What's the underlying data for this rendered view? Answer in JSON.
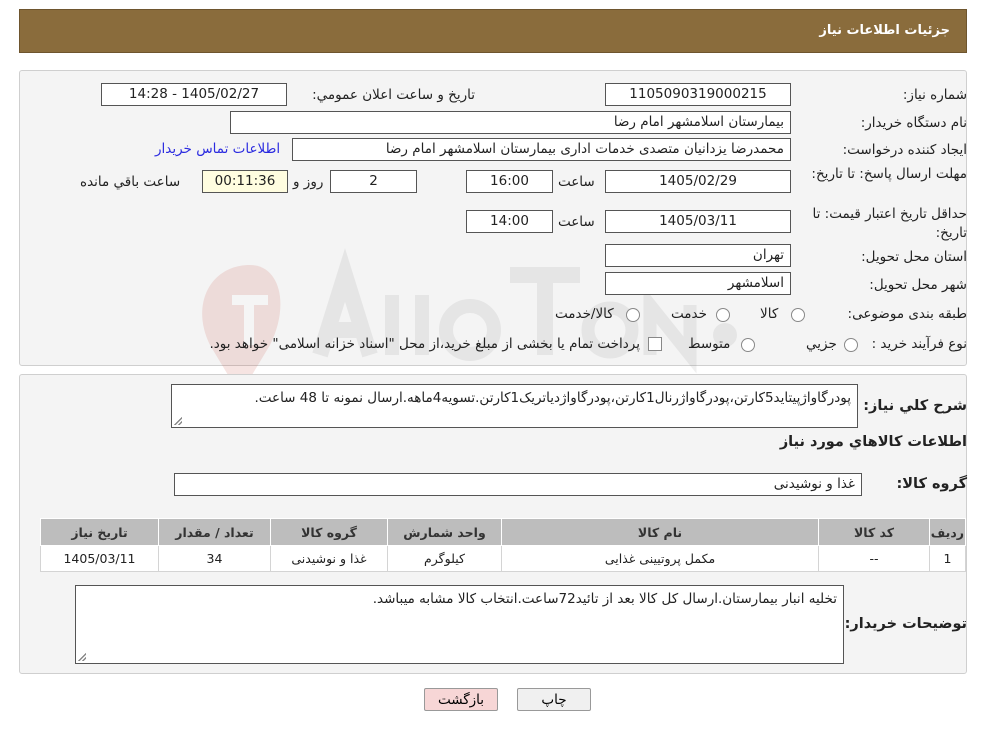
{
  "header": {
    "title": "جزئیات اطلاعات نیاز"
  },
  "labels": {
    "need_number": "شماره نیاز:",
    "announce_datetime": "تاريخ و ساعت اعلان عمومي:",
    "buyer_org": "نام دستگاه خريدار:",
    "requester": "ایجاد کننده درخواست:",
    "contact_link": "اطلاعات تماس خريدار",
    "reply_deadline": "مهلت ارسال پاسخ: تا تاريخ:",
    "time": "ساعت",
    "days_and": "روز و",
    "remaining": "ساعت باقي مانده",
    "price_validity": "حداقل تاريخ اعتبار قيمت: تا تاريخ:",
    "delivery_province": "استان محل تحويل:",
    "delivery_city": "شهر محل تحويل:",
    "category": "طبقه بندی موضوعی:",
    "purchase_process": "نوع فرآيند خريد :",
    "general_desc": "شرح كلي نياز:",
    "goods_info": "اطلاعات كالاهاي مورد نياز",
    "goods_group": "گروه کالا:",
    "buyer_notes": "توضیحات خریدار:"
  },
  "values": {
    "need_number": "1105090319000215",
    "announce_datetime": "1405/02/27 - 14:28",
    "buyer_org": "بیمارستان اسلامشهر   امام رضا",
    "requester": "محمدرضا یزدانیان متصدی خدمات اداری بیمارستان اسلامشهر   امام رضا",
    "reply_date": "1405/02/29",
    "reply_time": "16:00",
    "reply_days": "2",
    "remaining_time": "00:11:36",
    "validity_date": "1405/03/11",
    "validity_time": "14:00",
    "province": "تهران",
    "city": "اسلامشهر",
    "general_desc": "پودرگاواژپیتاید5کارتن،پودرگاواژرنال1کارتن،پودرگاواژدیاتریک1کارتن.تسویه4ماهه.ارسال نمونه تا 48 ساعت.",
    "goods_group": "غذا و نوشیدنی",
    "buyer_notes": "تخلیه انبار بیمارستان.ارسال کل کالا بعد از تائید72ساعت.انتخاب کالا مشابه میباشد."
  },
  "category_options": [
    {
      "label": "کالا",
      "selected": false
    },
    {
      "label": "خدمت",
      "selected": false
    },
    {
      "label": "کالا/خدمت",
      "selected": false
    }
  ],
  "purchase_options": [
    {
      "label": "جزيي",
      "selected": false
    },
    {
      "label": "متوسط",
      "selected": false
    }
  ],
  "purchase_note": "پرداخت تمام یا بخشی از مبلغ خرید،از محل \"اسناد خزانه اسلامی\" خواهد بود.",
  "table": {
    "headers": [
      "رديف",
      "کد کالا",
      "نام کالا",
      "واحد شمارش",
      "گروه کالا",
      "تعداد / مقدار",
      "تاريخ نياز"
    ],
    "rows": [
      [
        "1",
        "--",
        "مکمل پروتیینی غذایی",
        "کیلوگرم",
        "غذا و نوشیدنی",
        "34",
        "1405/03/11"
      ]
    ]
  },
  "buttons": {
    "print": "چاپ",
    "back": "بازگشت"
  },
  "colors": {
    "header_bg": "#8a6c3c",
    "link": "#2b2be0",
    "back_button": "#f7d6d6"
  }
}
